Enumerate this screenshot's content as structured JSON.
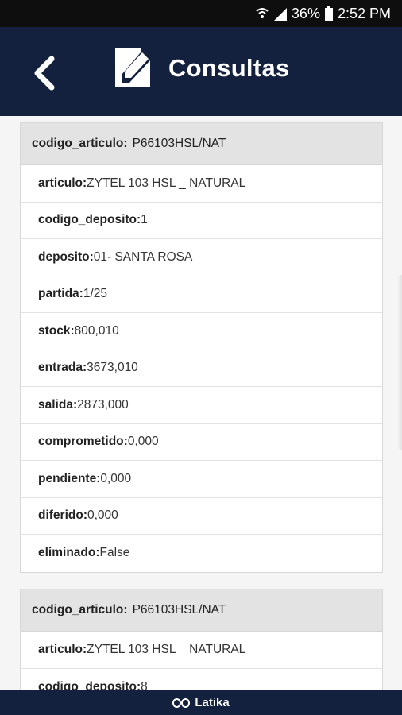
{
  "status_bar": {
    "battery": "36%",
    "time": "2:52 PM",
    "icons": [
      "wifi-icon",
      "signal-icon",
      "battery-icon"
    ]
  },
  "header": {
    "title": "Consultas",
    "background": "#13213f",
    "icons": [
      "back-arrow-icon",
      "edit-document-icon"
    ]
  },
  "records": [
    {
      "head_key": "codigo_articulo:",
      "head_value": "P66103HSL/NAT",
      "fields": [
        {
          "key": "articulo:",
          "value": "ZYTEL 103 HSL _ NATURAL"
        },
        {
          "key": "codigo_deposito:",
          "value": "1"
        },
        {
          "key": "deposito:",
          "value": "01- SANTA ROSA"
        },
        {
          "key": "partida:",
          "value": "1/25"
        },
        {
          "key": "stock:",
          "value": "800,010"
        },
        {
          "key": "entrada:",
          "value": "3673,010"
        },
        {
          "key": "salida:",
          "value": "2873,000"
        },
        {
          "key": "comprometido:",
          "value": "0,000"
        },
        {
          "key": "pendiente:",
          "value": "0,000"
        },
        {
          "key": "diferido:",
          "value": "0,000"
        },
        {
          "key": "eliminado:",
          "value": "False"
        }
      ]
    },
    {
      "head_key": "codigo_articulo:",
      "head_value": "P66103HSL/NAT",
      "fields": [
        {
          "key": "articulo:",
          "value": "ZYTEL 103 HSL _ NATURAL"
        },
        {
          "key": "codigo_deposito:",
          "value": "8"
        }
      ]
    }
  ],
  "footer": {
    "brand": "Latika",
    "icon": "latika-logo-icon"
  }
}
